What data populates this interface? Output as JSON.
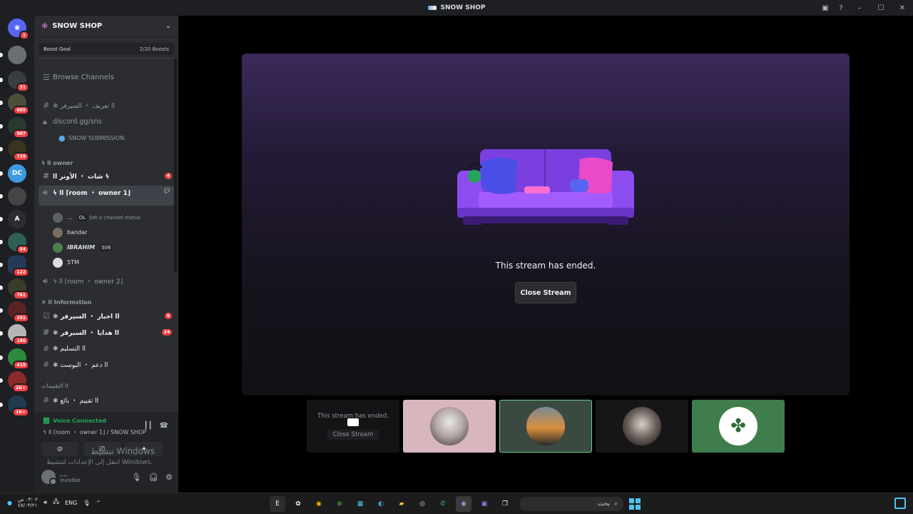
{
  "window": {
    "title": "SNOW SHOP",
    "controls": {
      "minimize": "–",
      "maximize": "☐",
      "close": "✕"
    }
  },
  "rail": {
    "home_badge": "1",
    "servers": [
      {
        "label": "",
        "badge": "",
        "color": "#6b6e73"
      },
      {
        "label": "",
        "badge": "31",
        "color": "#3a3c43"
      },
      {
        "label": "",
        "badge": "605",
        "color": "#4a4f38"
      },
      {
        "label": "",
        "badge": "907",
        "color": "#2a3a2e"
      },
      {
        "label": "",
        "badge": "739",
        "color": "#3b3320"
      },
      {
        "label": "DC",
        "badge": "",
        "color": "#3d9be0"
      },
      {
        "label": "",
        "badge": "",
        "color": "#454545"
      },
      {
        "label": "A",
        "badge": "",
        "color": "#2b2d31"
      },
      {
        "label": "",
        "badge": "54",
        "color": "#2f5f55"
      },
      {
        "label": "",
        "badge": "122",
        "color": "#263a56"
      },
      {
        "label": "",
        "badge": "761",
        "color": "#3b3b2b"
      },
      {
        "label": "",
        "badge": "291",
        "color": "#5a2323"
      },
      {
        "label": "",
        "badge": "186",
        "color": "#b6b6b6"
      },
      {
        "label": "",
        "badge": "419",
        "color": "#2c8a3e"
      },
      {
        "label": "",
        "badge": "2K+",
        "color": "#8a2a2a"
      },
      {
        "label": "",
        "badge": "1K+",
        "color": "#1f3c4e"
      }
    ]
  },
  "sidebar": {
    "server_name": "SNOW SHOP",
    "boost_label": "Boost Goal",
    "boost_value": "2/20 Boosts",
    "browse": "Browse Channels",
    "ch_intro": "❄ اا تعريف ・ السيرفر",
    "ch_invite": "discord.gg/sns",
    "ch_submission": "SNOW SUBMISSION",
    "cat_owner": "ϟ اا owner",
    "ch_owner_chat": "شات ・ الأونر اا ϟ",
    "ch_owner_chat_cnt": "4",
    "voice_room1": "ϟ اا ⌈room ・ owner 1⌋",
    "channel_status": "Set a channel status",
    "members": [
      {
        "name": "...",
        "tag": "OL"
      },
      {
        "name": "bandar",
        "tag": ""
      },
      {
        "name": "IBRAHIM",
        "tag": "506"
      },
      {
        "name": "5TM",
        "tag": ""
      }
    ],
    "voice_room2": "ϟ اا ⌈room ・ owner 2⌋",
    "cat_info": "❄ اا Informstion",
    "ch_news": "❄ اا اخبار ・ السيرفر",
    "ch_news_cnt": "6",
    "ch_gifts": "❄ اا هدايا ・ السيرفر",
    "ch_gifts_cnt": "24",
    "ch_delivery": "❄ اا التسليم",
    "ch_boost": "❄ اا دعم ・ البوست",
    "cat_reviews": "اا التقييمات",
    "ch_review": "❄ اا تقييم ・ بائع"
  },
  "voice": {
    "status": "Voice Connected",
    "room": "ϟ اا ⌈room ・ owner 1⌋ / SNOW SHOP"
  },
  "user": {
    "name": "....",
    "status": "Invisible"
  },
  "watermark": {
    "line1": "تنشيط Windows",
    "line2": "انتقل إلى الإعدادات لتنشيط Windows."
  },
  "stream": {
    "ended_text": "This stream has ended.",
    "close_label": "Close Stream",
    "thumb_ended_text": "This stream has ended.",
    "thumb_close_label": "Close Stream"
  },
  "taskbar": {
    "clock_time": "٠٣:٠٢ ص",
    "clock_date": "٤٧/٠٣/٢١",
    "lang": "ENG",
    "search_placeholder": "بحث"
  }
}
